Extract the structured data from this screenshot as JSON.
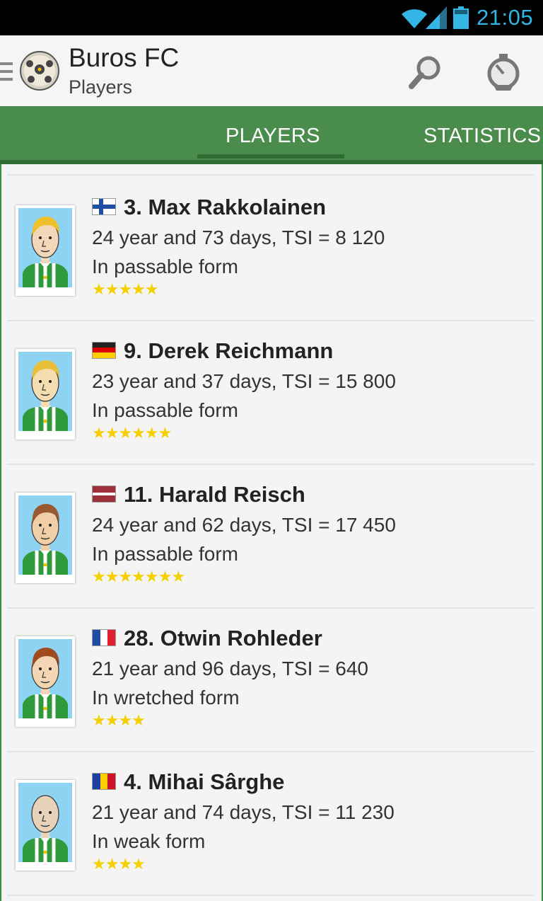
{
  "status_bar": {
    "time": "21:05",
    "wifi_icon": "wifi-icon",
    "signal_icon": "signal-icon",
    "battery_icon": "battery-icon"
  },
  "action_bar": {
    "title": "Buros FC",
    "subtitle": "Players",
    "logo": "football-icon",
    "search_icon": "search-icon",
    "stats_icon": "stopwatch-icon"
  },
  "tabs": [
    {
      "label": "PLAYERS",
      "selected": true
    },
    {
      "label": "STATISTICS",
      "selected": false
    }
  ],
  "players": [
    {
      "name": "3. Max Rakkolainen",
      "info": "24 year and 73 days, TSI = 8 120",
      "form": "In passable form",
      "stars": 5,
      "flag": "finland",
      "hair": "#f0c02a",
      "skin": "#f2d7b8"
    },
    {
      "name": "9. Derek Reichmann",
      "info": "23 year and 37 days, TSI = 15 800",
      "form": "In passable form",
      "stars": 6,
      "flag": "germany",
      "hair": "#e8c038",
      "skin": "#f4ddb0"
    },
    {
      "name": "11. Harald Reisch",
      "info": "24 year and 62 days, TSI = 17 450",
      "form": "In passable form",
      "stars": 7,
      "flag": "latvia",
      "hair": "#9a5a30",
      "skin": "#f0cfa8"
    },
    {
      "name": "28. Otwin Rohleder",
      "info": "21 year and 96 days, TSI = 640",
      "form": "In wretched form",
      "stars": 4,
      "flag": "france",
      "hair": "#a04a20",
      "skin": "#f4d6b4"
    },
    {
      "name": "4. Mihai Sârghe",
      "info": "21 year and 74 days, TSI = 11 230",
      "form": "In weak form",
      "stars": 4,
      "flag": "romania",
      "hair": "none",
      "skin": "#e8d2ba"
    }
  ],
  "colors": {
    "accent_green": "#4a8c4c",
    "star_yellow": "#f5d000",
    "status_blue": "#33b5e5"
  }
}
